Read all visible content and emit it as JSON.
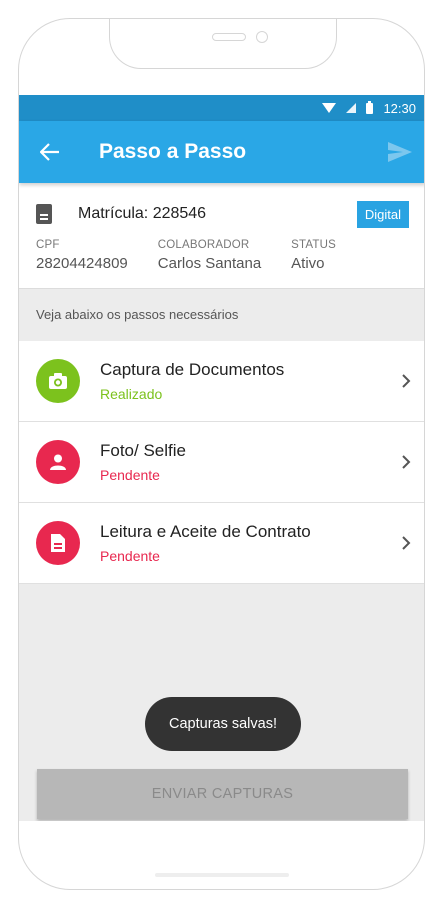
{
  "status_bar": {
    "time": "12:30"
  },
  "app_bar": {
    "title": "Passo a Passo",
    "back_icon": "arrow-left-icon",
    "send_icon": "send-icon"
  },
  "info": {
    "matricula": "Matrícula: 228546",
    "badge": "Digital",
    "fields": [
      {
        "label": "CPF",
        "value": "28204424809"
      },
      {
        "label": "COLABORADOR",
        "value": "Carlos Santana"
      },
      {
        "label": "STATUS",
        "value": "Ativo"
      }
    ]
  },
  "hint": "Veja abaixo os passos necessários",
  "steps": [
    {
      "title": "Captura de Documentos",
      "status": "Realizado",
      "icon": "camera-icon",
      "color": "#7cc21d"
    },
    {
      "title": "Foto/ Selfie",
      "status": "Pendente",
      "icon": "person-icon",
      "color": "#e8284f"
    },
    {
      "title": "Leitura e Aceite de Contrato",
      "status": "Pendente",
      "icon": "document-icon",
      "color": "#e8284f"
    }
  ],
  "toast": "Capturas salvas!",
  "submit_button": "ENVIAR CAPTURAS",
  "colors": {
    "primary": "#2aa7e6",
    "status_bar": "#1f8ec8",
    "success": "#7cc21d",
    "pending": "#e8284f"
  }
}
